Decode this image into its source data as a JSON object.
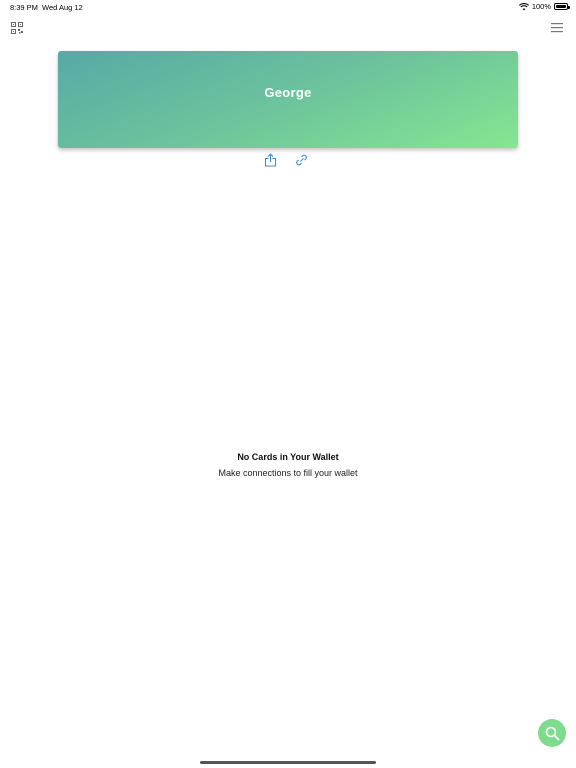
{
  "status_bar": {
    "time": "8:39 PM",
    "date": "Wed Aug 12",
    "battery": "100%"
  },
  "profile": {
    "name": "George",
    "gradient_start": "#56a9a6",
    "gradient_end": "#86e691"
  },
  "actions": {
    "share_icon": "share-icon",
    "link_icon": "link-icon",
    "color": "#3b8fd6"
  },
  "empty_state": {
    "title": "No Cards in Your Wallet",
    "subtitle": "Make connections to fill your wallet"
  },
  "fab": {
    "icon": "search-icon",
    "color": "#7fdc8e"
  }
}
